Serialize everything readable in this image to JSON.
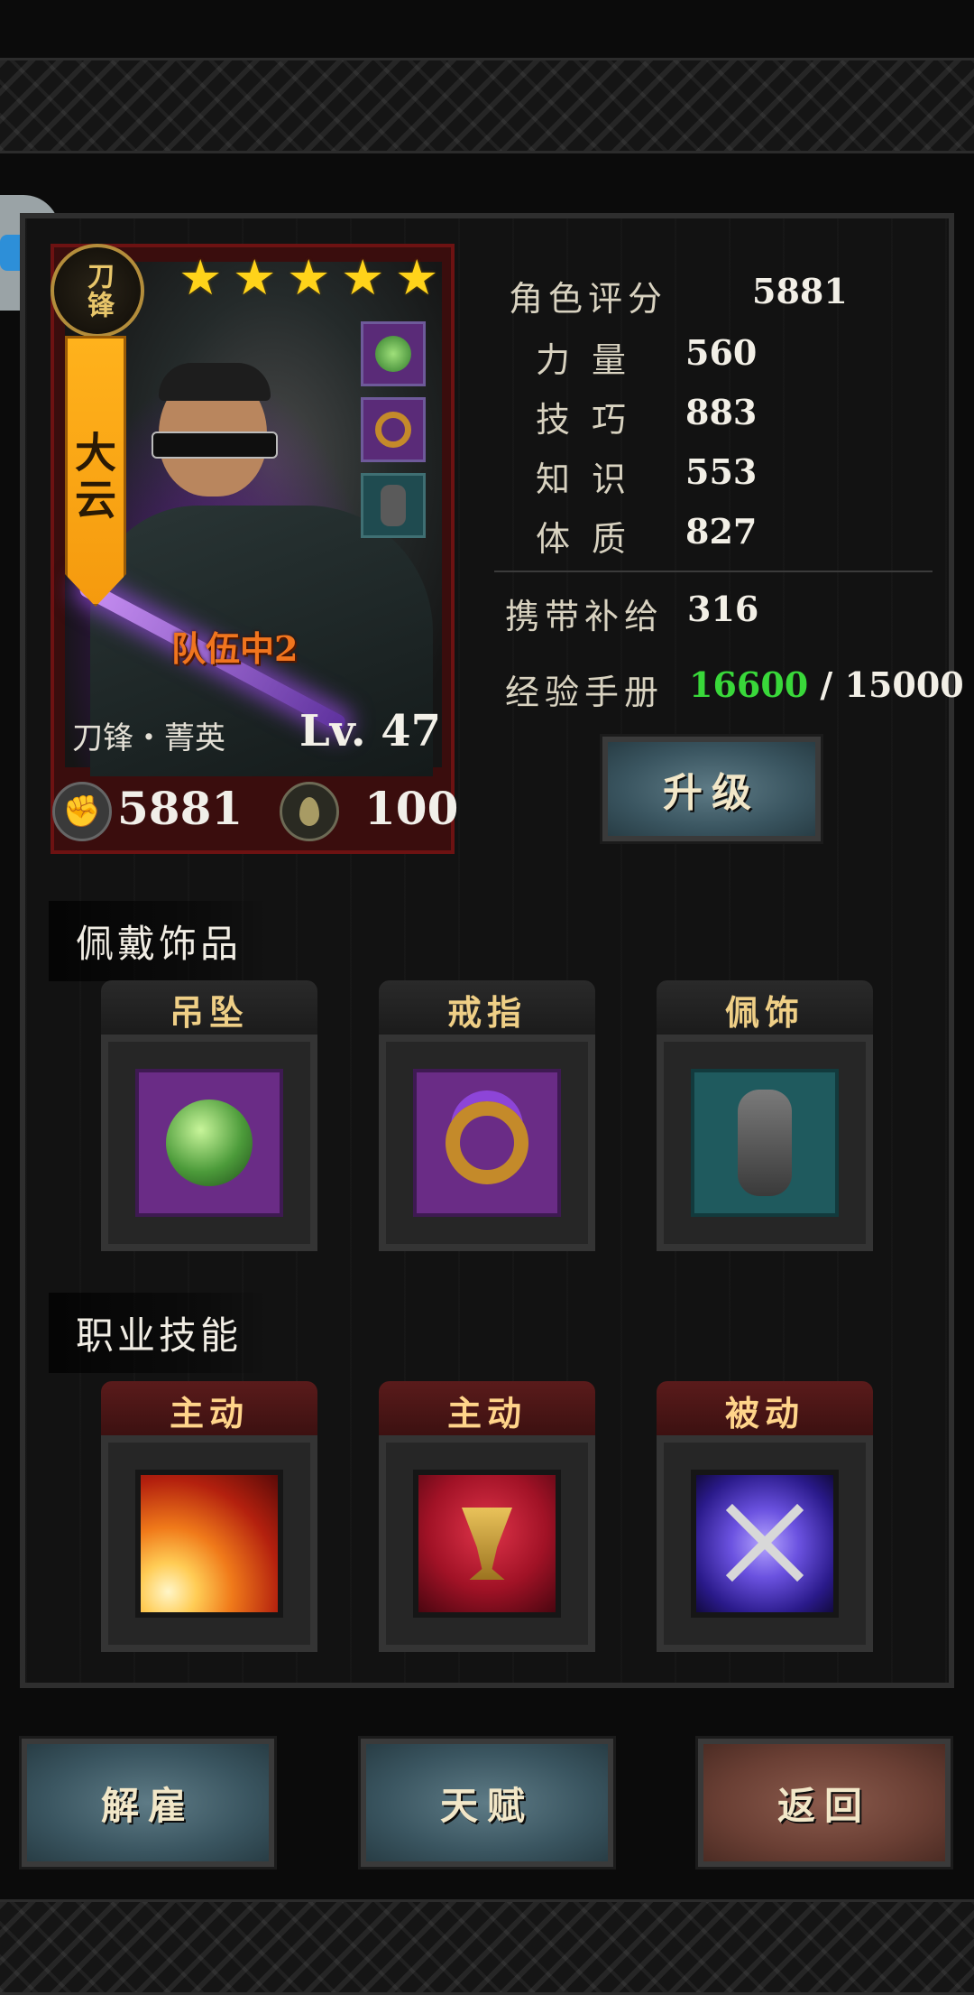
{
  "hero": {
    "class_badge": "刀锋",
    "name": "大云",
    "stars": 5,
    "team_label": "队伍中2",
    "class_rank": "刀锋・菁英",
    "level": "Lv. 47",
    "power": "5881",
    "supply_icon_value": "100",
    "portrait_slots": [
      "pendant-icon",
      "ring-icon",
      "ornament-icon"
    ]
  },
  "stats": {
    "rating_label": "角色评分",
    "rating_value": "5881",
    "strength_label": "力量",
    "strength_value": "560",
    "skill_label": "技巧",
    "skill_value": "883",
    "knowledge_label": "知识",
    "knowledge_value": "553",
    "constitution_label": "体质",
    "constitution_value": "827",
    "supply_label": "携带补给",
    "supply_value": "316",
    "exp_label": "经验手册",
    "exp_current": "16600",
    "exp_separator": " / ",
    "exp_required": "15000",
    "exp_current_color": "#39d83a"
  },
  "upgrade_button": "升级",
  "accessories": {
    "title": "佩戴饰品",
    "slots": [
      {
        "label": "吊坠",
        "icon": "jade-pendant-icon",
        "bg": "#6a2c86"
      },
      {
        "label": "戒指",
        "icon": "purple-ring-icon",
        "bg": "#6a2c86"
      },
      {
        "label": "佩饰",
        "icon": "iron-ornament-icon",
        "bg": "#1f5a5e"
      }
    ]
  },
  "skills": {
    "title": "职业技能",
    "slots": [
      {
        "label": "主动",
        "icon": "burst-slash-icon"
      },
      {
        "label": "主动",
        "icon": "blood-chalice-icon"
      },
      {
        "label": "被动",
        "icon": "crossed-swords-icon"
      }
    ]
  },
  "bottom_buttons": {
    "dismiss": "解雇",
    "talent": "天赋",
    "back": "返回"
  }
}
